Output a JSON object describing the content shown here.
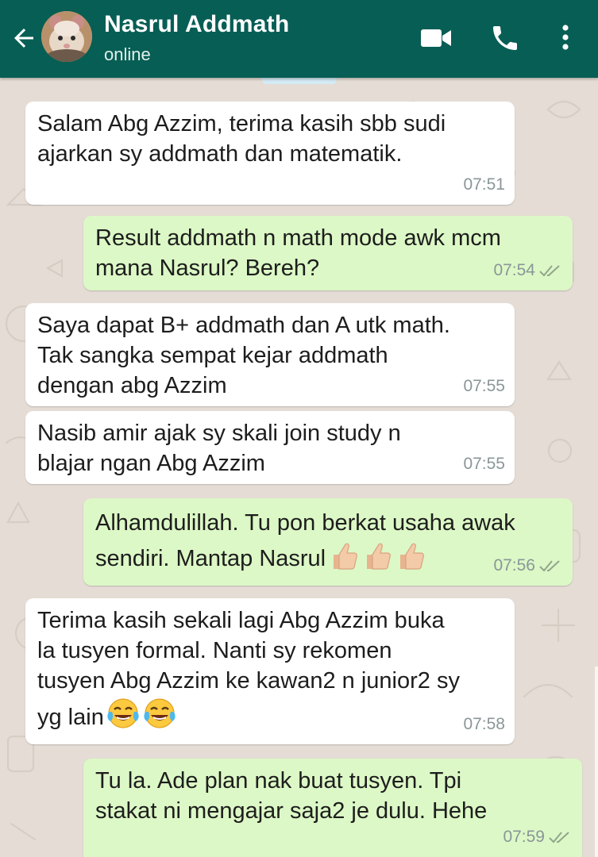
{
  "header": {
    "contact_name": "Nasrul Addmath",
    "status": "online"
  },
  "messages": [
    {
      "direction": "incoming",
      "lines": [
        "Salam Abg Azzim, terima kasih sbb sudi",
        "ajarkan sy addmath dan matematik."
      ],
      "time": "07:51"
    },
    {
      "direction": "outgoing",
      "lines": [
        "Result addmath n math mode awk mcm",
        "mana Nasrul? Bereh?"
      ],
      "time": "07:54",
      "status_icon": "double-check-icon"
    },
    {
      "direction": "incoming",
      "lines": [
        "Saya dapat B+ addmath dan A utk math.",
        "Tak sangka sempat kejar addmath",
        "dengan abg Azzim"
      ],
      "time": "07:55"
    },
    {
      "direction": "incoming",
      "lines": [
        "Nasib amir ajak sy skali join study n",
        "blajar ngan Abg Azzim"
      ],
      "time": "07:55"
    },
    {
      "direction": "outgoing",
      "lines": [
        "Alhamdulillah. Tu pon berkat usaha awak",
        "sendiri. Mantap Nasrul"
      ],
      "time": "07:56",
      "emoji": "thumbs-up",
      "emoji_count": 3,
      "status_icon": "double-check-icon"
    },
    {
      "direction": "incoming",
      "lines": [
        "Terima kasih sekali lagi Abg Azzim buka",
        "la tusyen formal. Nanti sy rekomen",
        "tusyen Abg Azzim ke kawan2 n junior2 sy",
        "yg lain"
      ],
      "time": "07:58",
      "emoji": "face-with-tears-of-joy",
      "emoji_count": 2
    },
    {
      "direction": "outgoing",
      "lines": [
        "Tu la. Ade plan nak buat tusyen. Tpi",
        "stakat ni mengajar saja2 je dulu. Hehe"
      ],
      "time": "07:59",
      "status_icon": "double-check-icon"
    }
  ],
  "colors": {
    "header": "#075e54",
    "wallpaper": "#e5ddd5",
    "incoming_bubble": "#ffffff",
    "outgoing_bubble": "#dcf8c6",
    "timestamp": "#8a9698"
  }
}
